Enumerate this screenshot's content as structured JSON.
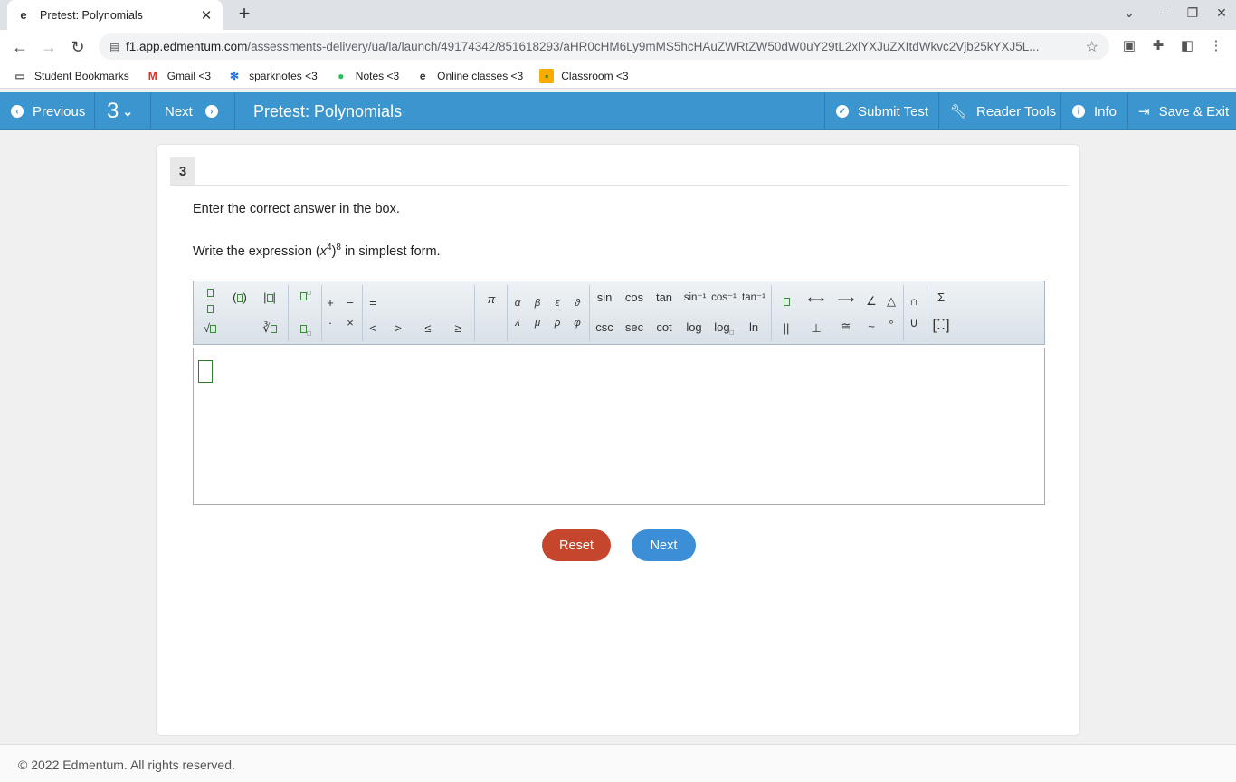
{
  "browser": {
    "tab_title": "Pretest: Polynomials",
    "favicon": "e",
    "url_host": "f1.app.edmentum.com",
    "url_path": "/assessments-delivery/ua/la/launch/49174342/851618293/aHR0cHM6Ly9mMS5hcHAuZWRtZW50dW0uY29tL2xlYXJuZXItdWkvc2Vjb25kYXJ5L...",
    "bookmarks": [
      {
        "icon": "folder-icon",
        "label": "Student Bookmarks"
      },
      {
        "icon": "gmail-icon",
        "label": "Gmail <3"
      },
      {
        "icon": "sparknotes-icon",
        "label": "sparknotes <3"
      },
      {
        "icon": "evernote-icon",
        "label": "Notes <3"
      },
      {
        "icon": "edmentum-icon",
        "label": "Online classes <3"
      },
      {
        "icon": "classroom-icon",
        "label": "Classroom <3"
      }
    ]
  },
  "appbar": {
    "previous": "Previous",
    "question_selector": "3",
    "next": "Next",
    "title": "Pretest: Polynomials",
    "submit": "Submit Test",
    "reader_tools": "Reader Tools",
    "info": "Info",
    "save_exit": "Save & Exit"
  },
  "question": {
    "number": "3",
    "instruction": "Enter the correct answer in the box.",
    "prompt_before": "Write the expression (",
    "prompt_var": "x",
    "prompt_exp_inner": "4",
    "prompt_close": ")",
    "prompt_exp_outer": "8",
    "prompt_after": " in simplest form."
  },
  "palette": {
    "top_row": [
      "π",
      "α",
      "β",
      "ε",
      "ϑ",
      "sin",
      "cos",
      "tan",
      "sin⁻¹",
      "cos⁻¹",
      "tan⁻¹",
      "∠",
      "△",
      "∩",
      "Σ"
    ],
    "bottom_row": [
      "<",
      ">",
      "≤",
      "≥",
      "λ",
      "μ",
      "ρ",
      "φ",
      "csc",
      "sec",
      "cot",
      "log",
      "ln",
      "||",
      "⊥",
      "≅",
      "~",
      "°",
      "∪"
    ],
    "ops": [
      "+",
      "−",
      "·",
      "×",
      "="
    ]
  },
  "buttons": {
    "reset": "Reset",
    "next": "Next"
  },
  "footer": "© 2022 Edmentum. All rights reserved."
}
